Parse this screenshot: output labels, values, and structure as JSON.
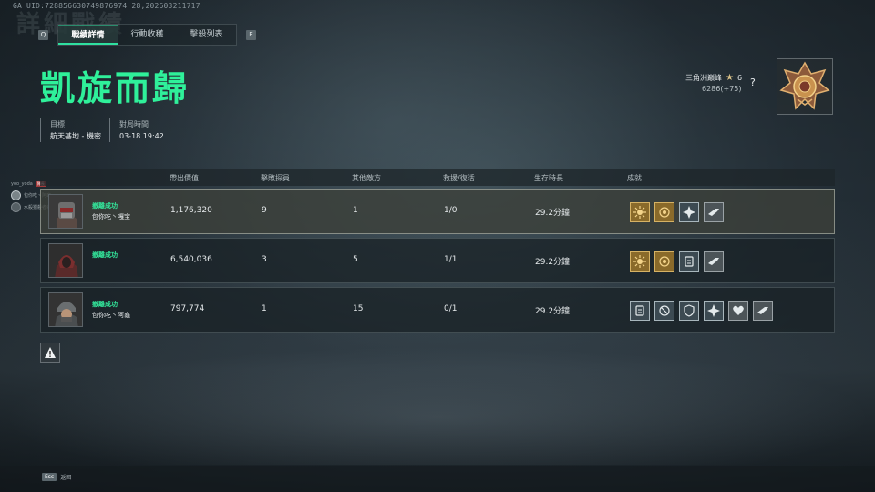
{
  "uid_text": "GA UID:728856630749876974 28,202603211717",
  "bg_title": "詳細戰績",
  "tabs": {
    "left_key": "Q",
    "right_key": "E",
    "items": [
      {
        "label": "戰績詳情",
        "active": true
      },
      {
        "label": "行動收穫",
        "active": false
      },
      {
        "label": "擊殺列表",
        "active": false
      }
    ]
  },
  "headline": "凱旋而歸",
  "meta": {
    "target_label": "目標",
    "target_value": "航天基地 - 機密",
    "time_label": "對局時間",
    "time_value": "03-18 19:42"
  },
  "rank": {
    "name": "三角洲巔峰",
    "stars": "6",
    "points": "6286(+75)",
    "help": "?"
  },
  "side_list": [
    {
      "name": "yoo_yoda",
      "tag": "隊長"
    },
    {
      "name": "包你吃丶阿龜",
      "tag": ""
    },
    {
      "name": "水殺獵殺者老大",
      "tag": ""
    }
  ],
  "table": {
    "headers": [
      "帶出價值",
      "擊敗探員",
      "其他敵方",
      "救援/復活",
      "生存時長",
      "成就"
    ],
    "rows": [
      {
        "status": "撤離成功",
        "name": "包你吃丶嘎宝",
        "value": "1,176,320",
        "kills": "9",
        "others": "1",
        "rescue": "1/0",
        "survival": "29.2分鐘",
        "highlight": true,
        "badges": [
          "gold",
          "gold",
          "silver",
          "gray"
        ]
      },
      {
        "status": "撤離成功",
        "name": "",
        "value": "6,540,036",
        "kills": "3",
        "others": "5",
        "rescue": "1/1",
        "survival": "29.2分鐘",
        "highlight": false,
        "badges": [
          "gold",
          "gold",
          "silver",
          "gray"
        ]
      },
      {
        "status": "撤離成功",
        "name": "包你吃丶阿龜",
        "value": "797,774",
        "kills": "1",
        "others": "15",
        "rescue": "0/1",
        "survival": "29.2分鐘",
        "highlight": false,
        "badges": [
          "silver",
          "silver",
          "silver",
          "silver",
          "gray",
          "gray"
        ]
      }
    ]
  },
  "footer": {
    "esc_key": "Esc",
    "esc_label": "返回"
  },
  "colors": {
    "accent": "#2ff09a",
    "success": "#33e89c",
    "gold": "#d6b264"
  }
}
